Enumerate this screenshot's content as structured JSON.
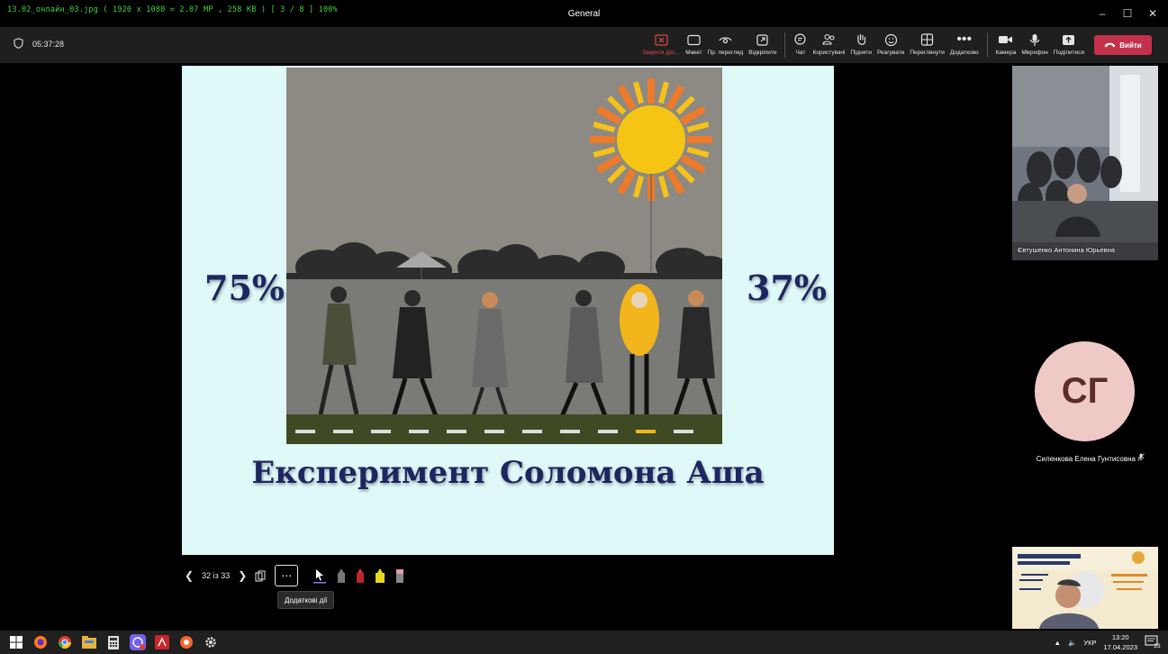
{
  "viewer": {
    "info": "13.02_онлайн_03.jpg  ( 1920 x 1080 = 2.07 MP  ,  258 KB )  [ 3 / 8 ]   100%"
  },
  "window": {
    "title": "General"
  },
  "meeting": {
    "elapsed": "05:37:28",
    "tools": {
      "stop_share": "Закрити дос...",
      "layout": "Макет",
      "presenter_view": "Пр. перегляд",
      "pop_out": "Відкріпити",
      "chat": "Чат",
      "people": "Користувачі",
      "raise": "Підняти",
      "react": "Реагувати",
      "view": "Переглянути",
      "more": "Додатково",
      "camera": "Камера",
      "mic": "Мікрофон",
      "share": "Поділитися"
    },
    "leave_label": "Вийти",
    "leave_color": "#c4314b"
  },
  "slide": {
    "left_percent": "75%",
    "right_percent": "37%",
    "title": "Експеримент Соломона Аша",
    "text_color": "#1d2660",
    "background": "#dff8f8"
  },
  "presentation_controls": {
    "page_count": "32 із 33",
    "more_tooltip": "Додаткові дії"
  },
  "participants": {
    "video_name": "Євтушенко Антонина Юрьевна",
    "avatar_initials": "СГ",
    "avatar_name": "Силенкова Елена Гунтисовна"
  },
  "taskbar": {
    "language": "УКР",
    "time": "13:20",
    "date": "17.04.2023",
    "notification_count": "23"
  }
}
